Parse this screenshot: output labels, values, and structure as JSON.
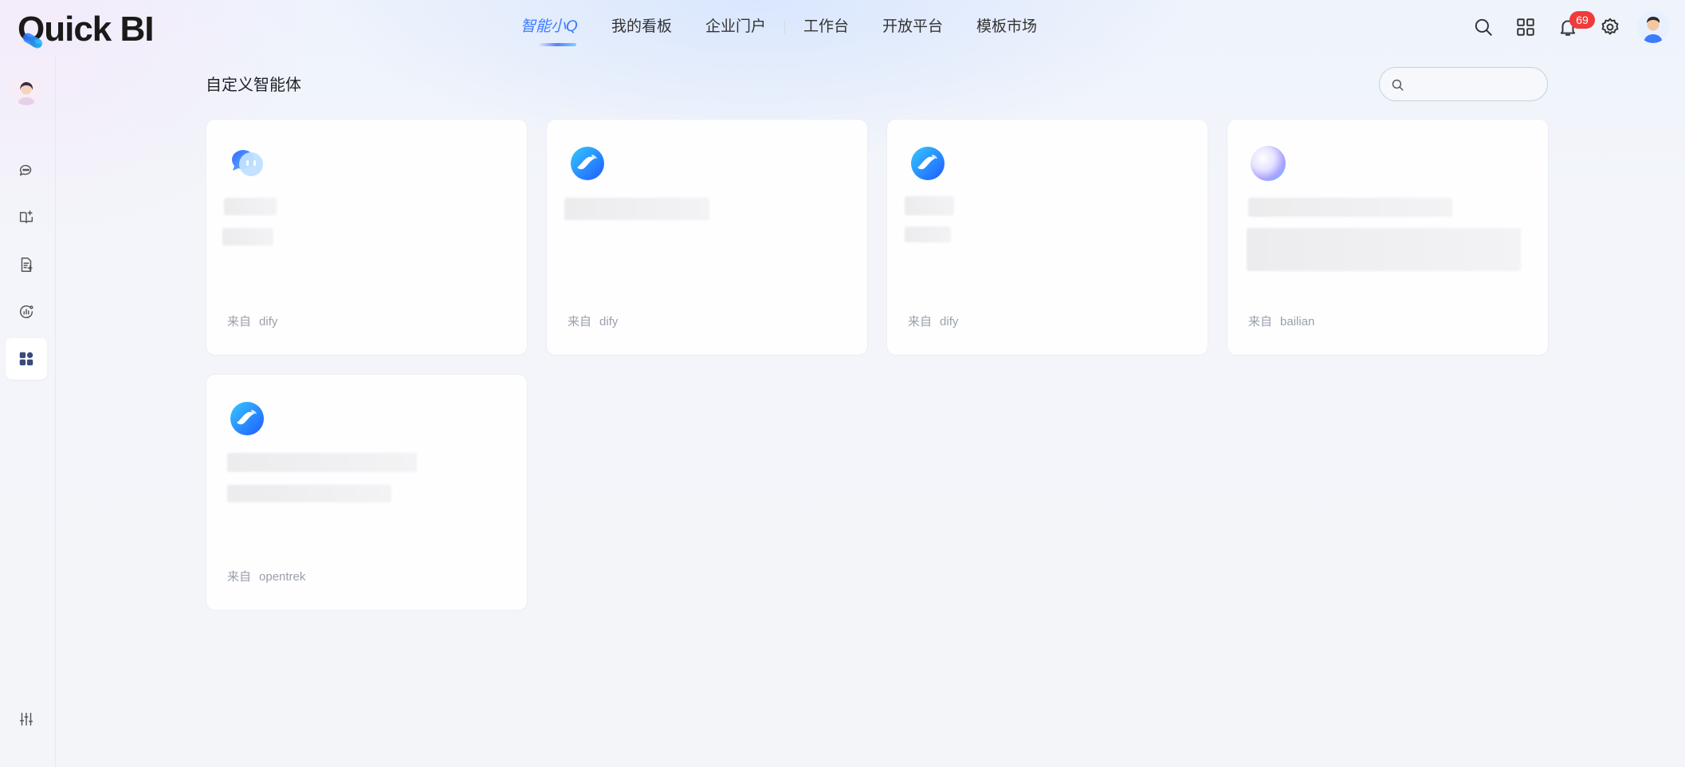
{
  "app": {
    "logo_text": "Quick BI"
  },
  "nav": {
    "items": [
      {
        "label": "智能小Q",
        "active": true
      },
      {
        "label": "我的看板"
      },
      {
        "label": "企业门户"
      },
      {
        "label": "工作台"
      },
      {
        "label": "开放平台"
      },
      {
        "label": "模板市场"
      }
    ]
  },
  "top_icons": {
    "search": "search-icon",
    "apps": "apps-grid-icon",
    "notifications": {
      "icon": "bell-icon",
      "count": "69"
    },
    "settings": "gear-icon",
    "user": "user-avatar"
  },
  "sidebar": {
    "items": [
      {
        "icon": "chat-bubbles-icon"
      },
      {
        "icon": "book-spark-icon"
      },
      {
        "icon": "report-icon"
      },
      {
        "icon": "data-agent-icon"
      },
      {
        "icon": "grid-apps-icon",
        "active": true
      }
    ],
    "bottom_icon": "sliders-icon"
  },
  "page": {
    "title": "自定义智能体",
    "search_placeholder": ""
  },
  "cards": [
    {
      "source_label": "来自",
      "source": "dify",
      "icon": "chat-bot-icon"
    },
    {
      "source_label": "来自",
      "source": "dify",
      "icon": "dify-sphere-icon"
    },
    {
      "source_label": "来自",
      "source": "dify",
      "icon": "dify-sphere-icon"
    },
    {
      "source_label": "来自",
      "source": "bailian",
      "icon": "bailian-orb-icon"
    },
    {
      "source_label": "来自",
      "source": "opentrek",
      "icon": "dify-sphere-icon"
    }
  ],
  "colors": {
    "accent": "#3b7cff",
    "badge": "#f03b3b",
    "muted_text": "#9aa0ab"
  }
}
